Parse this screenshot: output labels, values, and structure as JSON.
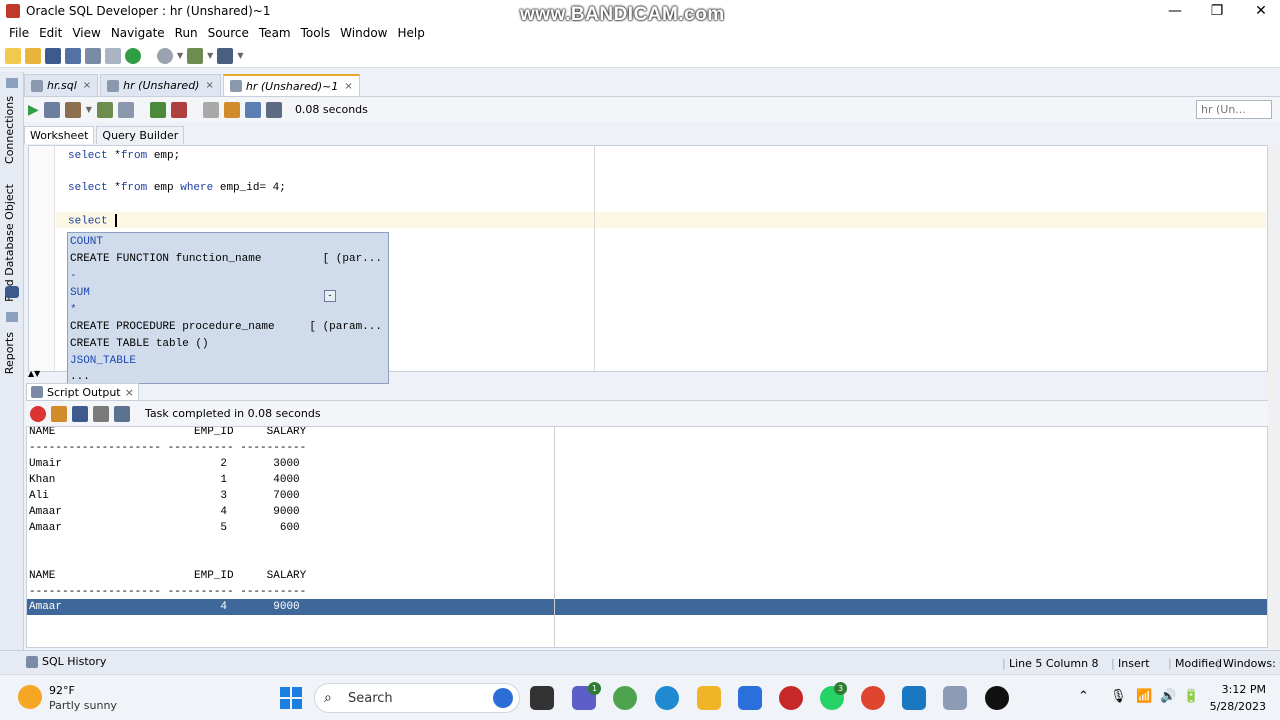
{
  "window": {
    "title": "Oracle SQL Developer : hr (Unshared)~1",
    "watermark": "www.BANDICAM.com",
    "minimize": "—",
    "maximize": "❐",
    "close": "✕"
  },
  "menu": [
    "File",
    "Edit",
    "View",
    "Navigate",
    "Run",
    "Source",
    "Team",
    "Tools",
    "Window",
    "Help"
  ],
  "left_panel": {
    "connections": "Connections",
    "find_db_object": "Find Database Object",
    "reports": "Reports"
  },
  "editor_tabs": [
    {
      "label": "hr.sql",
      "active": false
    },
    {
      "label": "hr (Unshared)",
      "active": false
    },
    {
      "label": "hr (Unshared)~1",
      "active": true
    }
  ],
  "editor_toolbar": {
    "elapsed": "0.08 seconds",
    "connection": "hr (Un..."
  },
  "sub_tabs": [
    "Worksheet",
    "Query Builder"
  ],
  "code": {
    "line1": {
      "kw1": "select",
      "rest1": " *",
      "kw2": "from",
      "rest2": " emp;"
    },
    "line2": {
      "kw1": "select",
      "rest1": " *",
      "kw2": "from",
      "rest2": " emp ",
      "kw3": "where",
      "rest3": " emp_id= 4;"
    },
    "line3": {
      "kw1": "select",
      "rest1": " "
    }
  },
  "autocomplete": {
    "items": [
      {
        "label": "COUNT",
        "hint": ""
      },
      {
        "label": "CREATE FUNCTION function_name",
        "hint": "[ (par..."
      },
      {
        "label": "-",
        "hint": ""
      },
      {
        "label": "SUM",
        "hint": ""
      },
      {
        "label": "*",
        "hint": ""
      },
      {
        "label": "CREATE PROCEDURE procedure_name",
        "hint": "[ (param..."
      },
      {
        "label": "CREATE TABLE table ()",
        "hint": ""
      },
      {
        "label": "JSON_TABLE",
        "hint": ""
      },
      {
        "label": "...",
        "hint": ""
      }
    ],
    "expander": "-"
  },
  "script_output": {
    "tab_label": "Script Output",
    "close": "×",
    "status": "Task completed in 0.08 seconds",
    "lines": [
      "NAME                     EMP_ID     SALARY",
      "-------------------- ---------- ----------",
      "Umair                        2       3000",
      "Khan                         1       4000",
      "Ali                          3       7000",
      "Amaar                        4       9000",
      "Amaar                        5        600",
      "",
      "",
      "NAME                     EMP_ID     SALARY",
      "-------------------- ---------- ----------",
      "Amaar                        4       9000"
    ]
  },
  "status_bar": {
    "sql_history": "SQL History",
    "position": "Line 5 Column 8",
    "mode": "Insert",
    "modified": "Modified",
    "os": "Windows: C"
  },
  "taskbar": {
    "temperature": "92°F",
    "condition": "Partly sunny",
    "search": "Search",
    "time": "3:12 PM",
    "date": "5/28/2023",
    "badge_teams": "1",
    "badge_whatsapp": "3"
  }
}
